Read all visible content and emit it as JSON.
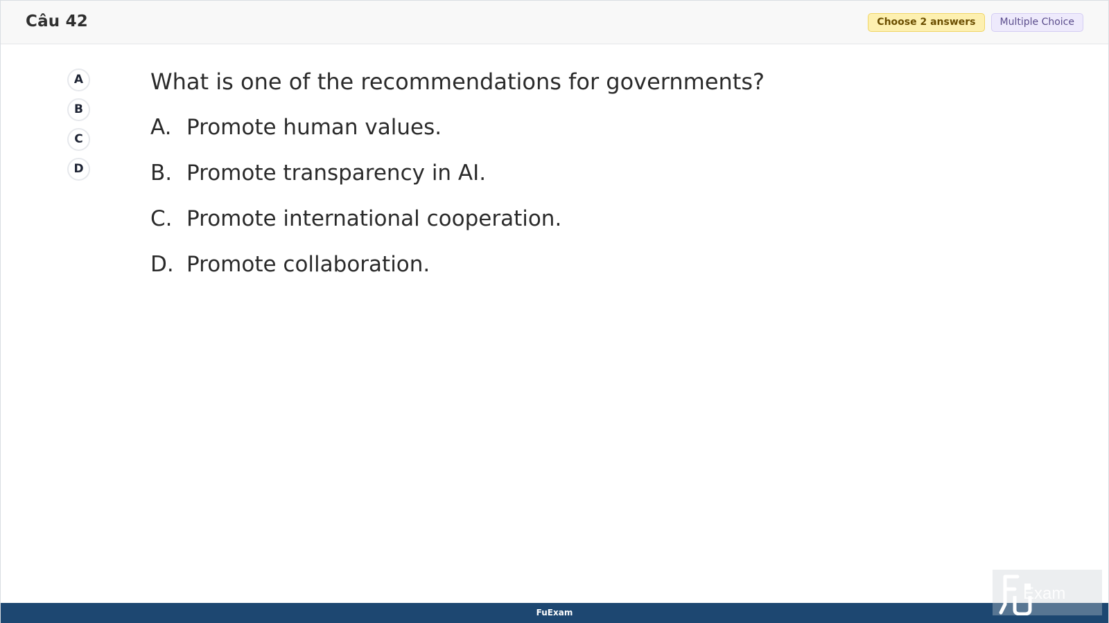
{
  "header": {
    "title": "Câu 42",
    "badges": {
      "choose": "Choose 2 answers",
      "type": "Multiple Choice"
    }
  },
  "choice_buttons": [
    "A",
    "B",
    "C",
    "D"
  ],
  "question": {
    "text": "What is one of the recommendations for governments?"
  },
  "options": [
    {
      "letter": "A.",
      "text": "Promote human values."
    },
    {
      "letter": "B.",
      "text": "Promote transparency in AI."
    },
    {
      "letter": "C.",
      "text": "Promote international cooperation."
    },
    {
      "letter": "D.",
      "text": "Promote collaboration."
    }
  ],
  "footer": {
    "brand": "FuExam"
  },
  "watermark": {
    "logo_text": "Exam"
  },
  "colors": {
    "header_bg": "#f8f8f8",
    "footer_bg": "#1d4771",
    "choose_badge_bg": "#fdf0b0",
    "type_badge_bg": "#eeeafc"
  }
}
